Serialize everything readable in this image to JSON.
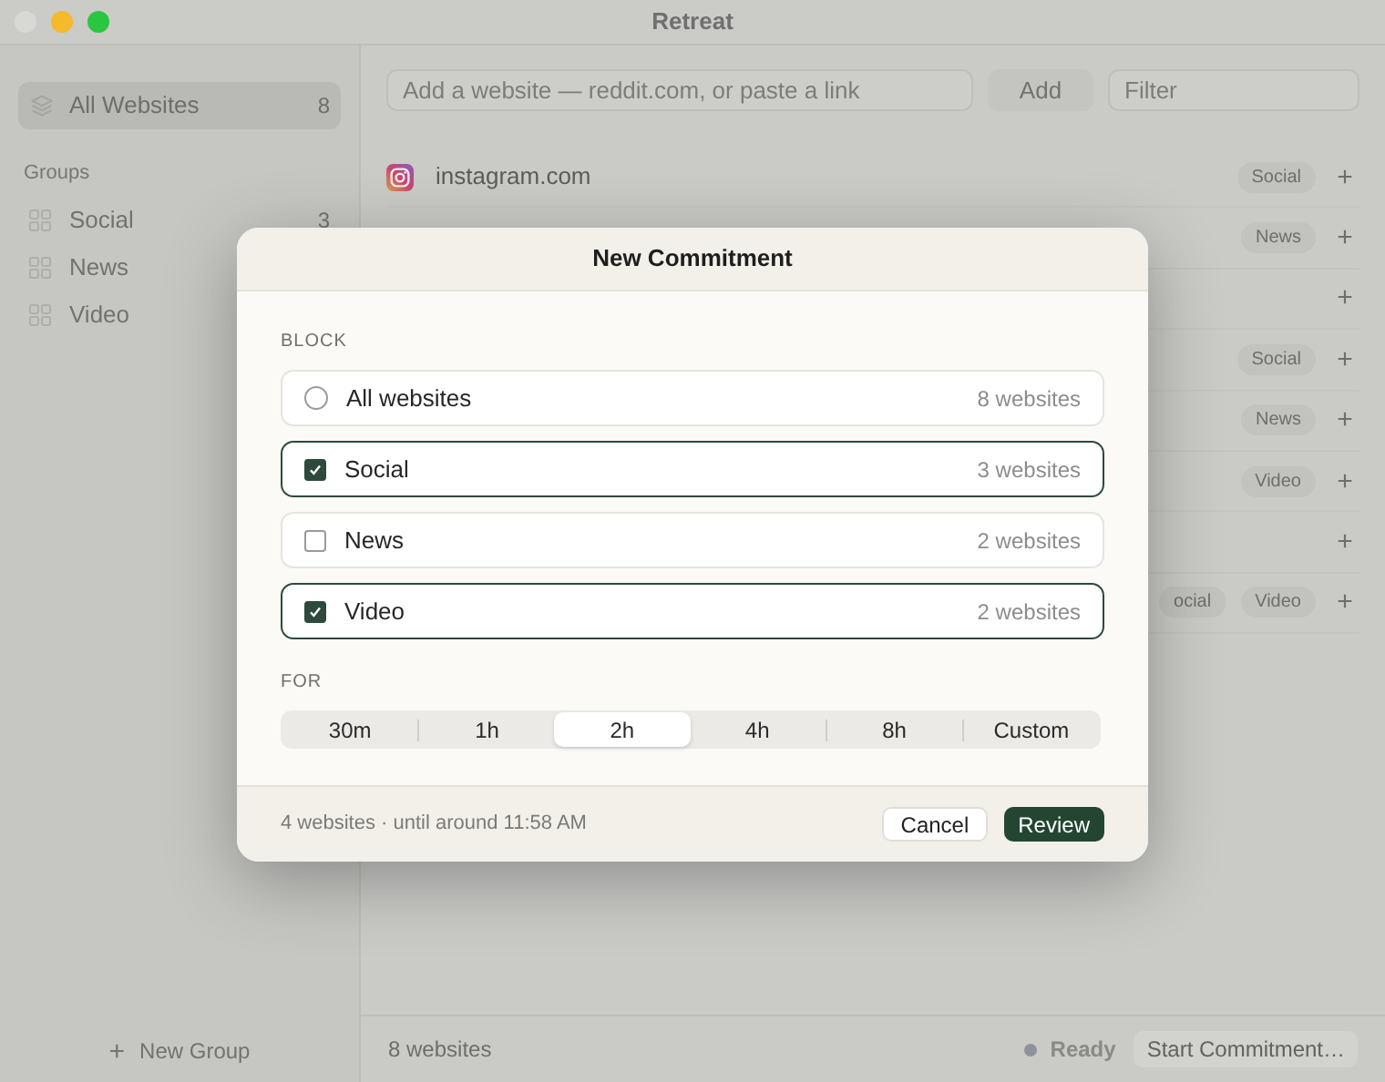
{
  "window": {
    "title": "Retreat"
  },
  "sidebar": {
    "all_item": {
      "label": "All Websites",
      "count": "8",
      "selected": true
    },
    "groups_heading": "Groups",
    "groups": [
      {
        "label": "Social",
        "count": "3"
      },
      {
        "label": "News"
      },
      {
        "label": "Video"
      }
    ],
    "new_group": {
      "icon": "+",
      "label": "New Group"
    }
  },
  "toolbar": {
    "add_field": {
      "placeholder": "Add a website — reddit.com, or paste a link"
    },
    "add_button": "Add",
    "filter": {
      "placeholder": "Filter"
    }
  },
  "sites": [
    {
      "domain": "instagram.com",
      "tags": [
        "Social"
      ],
      "add": "+"
    },
    {
      "tags": [
        "News"
      ],
      "add": "+"
    },
    {
      "add": "+"
    },
    {
      "tags": [
        "Social"
      ],
      "add": "+"
    },
    {
      "tags": [
        "News"
      ],
      "add": "+"
    },
    {
      "tags": [
        "Video"
      ],
      "add": "+"
    },
    {
      "add": "+"
    },
    {
      "tags": [
        "ocial",
        "Video"
      ],
      "add": "+"
    }
  ],
  "status_bar": {
    "count": "8 websites",
    "status": "Ready",
    "start_button": "Start Commitment…"
  },
  "dialog": {
    "title": "New Commitment",
    "block_label": "BLOCK",
    "options": [
      {
        "kind": "radio",
        "label": "All websites",
        "count": "8 websites",
        "checked": false
      },
      {
        "kind": "checkbox",
        "label": "Social",
        "count": "3 websites",
        "checked": true
      },
      {
        "kind": "checkbox",
        "label": "News",
        "count": "2 websites",
        "checked": false
      },
      {
        "kind": "checkbox",
        "label": "Video",
        "count": "2 websites",
        "checked": true
      }
    ],
    "for_label": "FOR",
    "durations": [
      {
        "label": "30m",
        "selected": false
      },
      {
        "label": "1h",
        "selected": false
      },
      {
        "label": "2h",
        "selected": true
      },
      {
        "label": "4h",
        "selected": false
      },
      {
        "label": "8h",
        "selected": false
      },
      {
        "label": "Custom",
        "selected": false
      }
    ],
    "summary": "4 websites · until around 11:58 AM",
    "cancel": "Cancel",
    "confirm": "Review"
  }
}
